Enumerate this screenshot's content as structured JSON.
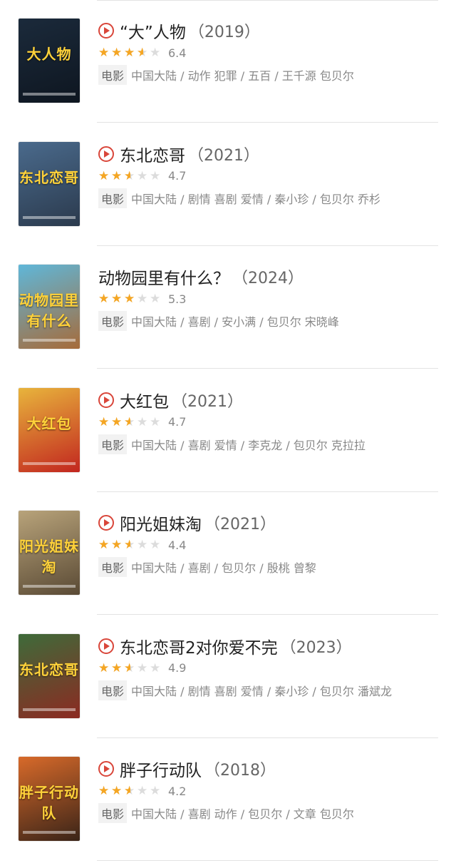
{
  "colors": {
    "accent": "#d9463a",
    "star": "#f5a623",
    "star_empty": "#dcdcdc"
  },
  "movies": [
    {
      "title": "“大”人物",
      "year": "（2019）",
      "rating": 3.5,
      "score": "6.4",
      "type": "电影",
      "meta": "中国大陆 / 动作 犯罪 / 五百 / 王千源 包贝尔",
      "playable": true,
      "poster_colors": [
        "#1b2a3b",
        "#0e1620"
      ],
      "poster_glyph": "大人物"
    },
    {
      "title": "东北恋哥",
      "year": "（2021）",
      "rating": 2.5,
      "score": "4.7",
      "type": "电影",
      "meta": "中国大陆 / 剧情 喜剧 爱情 / 秦小珍 / 包贝尔 乔杉",
      "playable": true,
      "poster_colors": [
        "#4a6a8c",
        "#2b3a4d"
      ],
      "poster_glyph": "东北恋哥"
    },
    {
      "title": "动物园里有什么？",
      "year": "（2024）",
      "rating": 3,
      "score": "5.3",
      "type": "电影",
      "meta": "中国大陆 / 喜剧 / 安小满 / 包贝尔 宋晓峰",
      "playable": false,
      "poster_colors": [
        "#5fb7d9",
        "#a66b3a"
      ],
      "poster_glyph": "动物园里有什么"
    },
    {
      "title": "大红包",
      "year": "（2021）",
      "rating": 2.5,
      "score": "4.7",
      "type": "电影",
      "meta": "中国大陆 / 喜剧 爱情 / 李克龙 / 包贝尔 克拉拉",
      "playable": true,
      "poster_colors": [
        "#e8b43c",
        "#c2261f"
      ],
      "poster_glyph": "大红包"
    },
    {
      "title": "阳光姐妹淘",
      "year": "（2021）",
      "rating": 2.5,
      "score": "4.4",
      "type": "电影",
      "meta": "中国大陆 / 喜剧 / 包贝尔 / 殷桃 曾黎",
      "playable": true,
      "poster_colors": [
        "#b8a37a",
        "#5a4a35"
      ],
      "poster_glyph": "阳光姐妹淘"
    },
    {
      "title": "东北恋哥2对你爱不完",
      "year": "（2023）",
      "rating": 2.5,
      "score": "4.9",
      "type": "电影",
      "meta": "中国大陆 / 剧情 喜剧 爱情 / 秦小珍 / 包贝尔 潘斌龙",
      "playable": true,
      "poster_colors": [
        "#3e6b3a",
        "#8c2a22"
      ],
      "poster_glyph": "东北恋哥"
    },
    {
      "title": "胖子行动队",
      "year": "（2018）",
      "rating": 2.5,
      "score": "4.2",
      "type": "电影",
      "meta": "中国大陆 / 喜剧 动作 / 包贝尔 / 文章 包贝尔",
      "playable": true,
      "poster_colors": [
        "#d86a2a",
        "#3a2418"
      ],
      "poster_glyph": "胖子行动队"
    }
  ]
}
